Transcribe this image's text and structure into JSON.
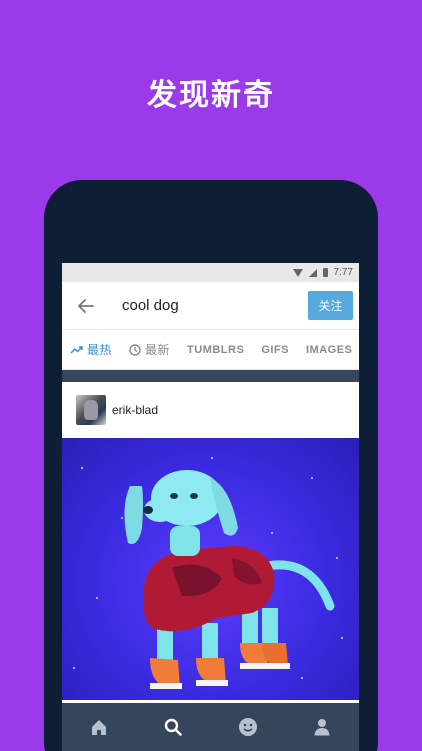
{
  "promo": {
    "title": "发现新奇"
  },
  "status_bar": {
    "time": "7:77"
  },
  "search": {
    "query": "cool dog",
    "follow_label": "关注"
  },
  "tabs": [
    {
      "label": "最热",
      "icon": "trending-icon",
      "active": true
    },
    {
      "label": "最新",
      "icon": "clock-icon",
      "active": false
    },
    {
      "label": "TUMBLRS",
      "active": false
    },
    {
      "label": "GIFS",
      "active": false
    },
    {
      "label": "IMAGES",
      "active": false
    }
  ],
  "post": {
    "username": "erik-blad",
    "image": "3d-cyan-dog-in-red-sweater"
  },
  "bottom_nav": [
    {
      "icon": "home-icon"
    },
    {
      "icon": "search-icon",
      "active": true
    },
    {
      "icon": "smiley-icon"
    },
    {
      "icon": "account-icon"
    }
  ],
  "colors": {
    "background": "#9b3ae8",
    "accent": "#55a9dc",
    "nav": "#35465c",
    "active_tab": "#3a8fd0"
  }
}
